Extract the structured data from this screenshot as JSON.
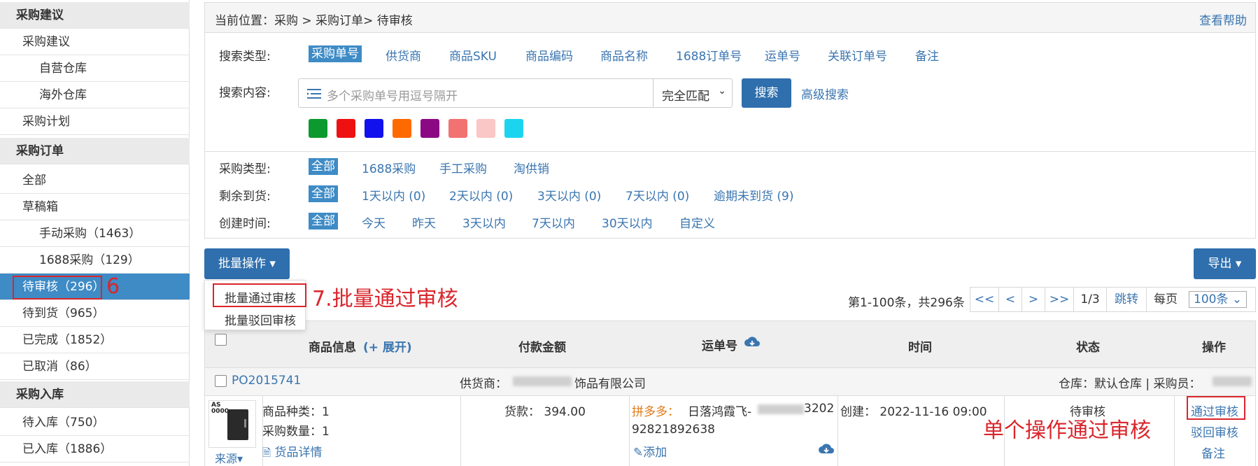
{
  "sidebar": {
    "items": [
      {
        "label": "采购建议"
      },
      {
        "label": "采购建议"
      },
      {
        "label": "自营仓库"
      },
      {
        "label": "海外仓库"
      },
      {
        "label": "采购计划"
      },
      {
        "label": "采购订单"
      },
      {
        "label": "全部"
      },
      {
        "label": "草稿箱"
      },
      {
        "label": "手动采购（1463）"
      },
      {
        "label": "1688采购（129）"
      },
      {
        "label": "待审核（296）"
      },
      {
        "label": "待到货（965）"
      },
      {
        "label": "已完成（1852）"
      },
      {
        "label": "已取消（86）"
      },
      {
        "label": "采购入库"
      },
      {
        "label": "待入库（750）"
      },
      {
        "label": "已入库（1886）"
      }
    ]
  },
  "annotations": {
    "step6": "6",
    "step7": "7.批量通过审核",
    "single": "单个操作通过审核"
  },
  "breadcrumb": {
    "text": "当前位置：采购 > 采购订单> 待审核",
    "help": "查看帮助"
  },
  "search": {
    "type_label": "搜索类型:",
    "types": [
      "采购单号",
      "供货商",
      "商品SKU",
      "商品编码",
      "商品名称",
      "1688订单号",
      "运单号",
      "关联订单号",
      "备注"
    ],
    "content_label": "搜索内容:",
    "placeholder": "多个采购单号用逗号隔开",
    "match_select": "完全匹配",
    "search_button": "搜索",
    "advanced": "高级搜索"
  },
  "colors": [
    "#0c9a2e",
    "#ee1111",
    "#1111ee",
    "#ff6a00",
    "#8b0a84",
    "#f27272",
    "#fbc6c6",
    "#1dd4f0"
  ],
  "filters": {
    "purchase_type": {
      "label": "采购类型:",
      "options": [
        "全部",
        "1688采购",
        "手工采购",
        "淘供销"
      ]
    },
    "remaining": {
      "label": "剩余到货:",
      "options": [
        "全部",
        "1天以内 (0)",
        "2天以内 (0)",
        "3天以内 (0)",
        "7天以内 (0)",
        "逾期未到货 (9)"
      ]
    },
    "created": {
      "label": "创建时间:",
      "options": [
        "全部",
        "今天",
        "昨天",
        "3天以内",
        "7天以内",
        "30天以内",
        "自定义"
      ]
    }
  },
  "toolbar": {
    "batch": "批量操作 ▾",
    "export": "导出 ▾"
  },
  "batch_menu": {
    "approve": "批量通过审核",
    "reject": "批量驳回审核"
  },
  "pagination": {
    "summary": "第1-100条，共296条",
    "first": "<<",
    "prev": "<",
    "next": ">",
    "last": ">>",
    "page": "1/3",
    "jump": "跳转",
    "per_page_label": "每页",
    "per_page": "100条"
  },
  "table": {
    "headers": {
      "goods": "商品信息",
      "expand": "(+ 展开)",
      "payment": "付款金额",
      "waybill": "运单号",
      "time": "时间",
      "status": "状态",
      "action": "操作"
    },
    "order": {
      "id": "PO2015741",
      "supplier": "供货商：",
      "supplier_name": "饰品有限公司",
      "warehouse": "仓库：默认仓库 | 采购员：",
      "kinds": "商品种类：1",
      "qty": "采购数量：1",
      "detail": "货品详情",
      "source": "来源",
      "payment": "货款：  394.00",
      "platform": "拼多多：",
      "waybill_prefix": "日落鸿霞飞-",
      "waybill_suffix": "3202",
      "waybill_no": "92821892638",
      "add": "添加",
      "created": "创建：  2022-11-16 09:00",
      "status": "待审核",
      "approve": "通过审核",
      "reject": "驳回审核",
      "remark": "备注"
    }
  }
}
